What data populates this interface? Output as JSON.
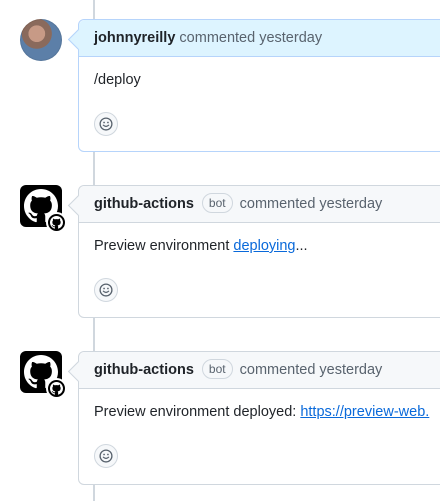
{
  "comments": [
    {
      "author": "johnnyreilly",
      "action": "commented yesterday",
      "body": "/deploy",
      "avatar": "user-avatar-icon"
    },
    {
      "author": "github-actions",
      "badge": "bot",
      "action": "commented yesterday",
      "body_prefix": "Preview environment ",
      "link_text": "deploying",
      "body_suffix": "...",
      "avatar": "github-actions-icon"
    },
    {
      "author": "github-actions",
      "badge": "bot",
      "action": "commented yesterday",
      "body_prefix": "Preview environment deployed: ",
      "link_text": "https://preview-web.",
      "avatar": "github-actions-icon"
    }
  ],
  "icons": {
    "reaction": "smiley-icon",
    "bot": "github-actions-icon"
  },
  "colors": {
    "link": "#0969da",
    "own_header_bg": "#ddf4ff",
    "header_bg": "#f6f8fa",
    "border": "#d0d7de"
  }
}
